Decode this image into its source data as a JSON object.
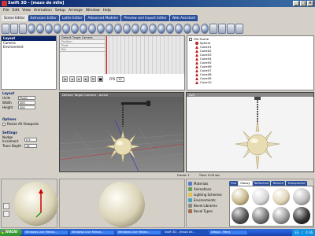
{
  "window": {
    "title": "Swift 3D - [mazo de mlle]",
    "minimize": "_",
    "maximize": "□",
    "close": "×"
  },
  "menu": [
    "File",
    "Edit",
    "View",
    "Animation",
    "Setup",
    "Arrange",
    "Window",
    "Help"
  ],
  "editor_tabs": [
    "Scene Editor",
    "Extrusion Editor",
    "Lathe Editor",
    "Advanced Modeler",
    "Preview and Export Editor",
    "Web Assistant"
  ],
  "layers": {
    "title": "Layout",
    "items": [
      "Camera",
      "Environment"
    ]
  },
  "layout_group": {
    "title": "Layout",
    "units_label": "Units",
    "units_value": "Pixels",
    "width_label": "Width",
    "width_value": "400",
    "height_label": "Height",
    "height_value": "300"
  },
  "options_group": {
    "title": "Options",
    "resize_label": "Resize All Viewports"
  },
  "settings_group": {
    "title": "Settings",
    "nudge_label": "Nudge Increment",
    "nudge_value": "0.5",
    "trans_label": "Trans Depth",
    "trans_value": "16"
  },
  "timeline": {
    "camera_label": "Default Target Camera",
    "rows": [
      "Position",
      "Pivot",
      "Rot"
    ],
    "fps_label": "FPS",
    "fps_value": "12"
  },
  "scene_tree": {
    "root": "File Scene",
    "items": [
      "Sphere",
      "Cone01",
      "Cone02",
      "Cone03",
      "Cone04",
      "Cone05",
      "Cone06",
      "Cone07",
      "Cone08",
      "Cone09",
      "Cone10"
    ]
  },
  "viewports": {
    "left_title": "Default Target Camera - active",
    "right_title": "Left"
  },
  "status": {
    "frame": "Frame: 1",
    "time": "Time: 0.00 sec"
  },
  "gallery": {
    "side_items": [
      "Materials",
      "Animations",
      "Lighting Schemes",
      "Environments",
      "Bevel Libraries",
      "Bevel Types"
    ],
    "tabs": [
      "Flat",
      "Glossy",
      "Reflective",
      "Texture",
      "Transparent"
    ],
    "active_tab": "Glossy"
  },
  "taskbar": {
    "start": "Inicio",
    "items": [
      "Windows Live Messe...",
      "Windows Live Messe...",
      "Windows Live Messe...",
      "Swift 3D - [mazo de...",
      "Dibujo - Paint"
    ],
    "active_index": 3,
    "tray_lang": "ES",
    "clock": "0:36"
  },
  "colors": {
    "title_bar": "#0a246a",
    "tab_blue": "#2b4f9a",
    "cone_red": "#b22222",
    "viewport_bg": "#6f6f6f",
    "taskbar_blue": "#245edb",
    "start_green": "#3c9b3c"
  }
}
